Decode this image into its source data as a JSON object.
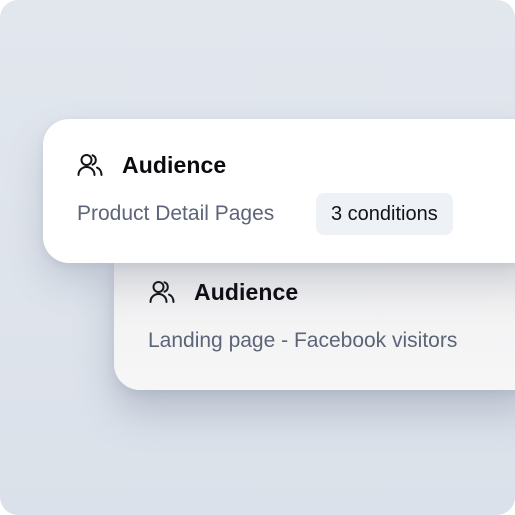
{
  "cards": [
    {
      "title": "Audience",
      "subtitle": "Product Detail Pages",
      "badge": "3 conditions",
      "icon": "users-icon"
    },
    {
      "title": "Audience",
      "subtitle": "Landing page - Facebook visitors",
      "icon": "users-icon"
    }
  ]
}
